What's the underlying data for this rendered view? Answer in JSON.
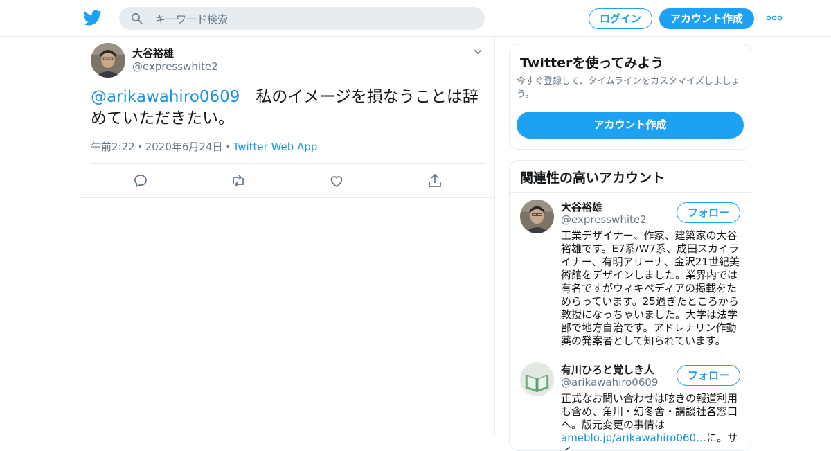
{
  "header": {
    "search_placeholder": "キーワード検索",
    "login_label": "ログイン",
    "signup_label": "アカウント作成"
  },
  "tweet": {
    "author_name": "大谷裕雄",
    "author_handle": "@expresswhite2",
    "mention": "@arikawahiro0609",
    "text": "　私のイメージを損なうことは辞めていただきたい。",
    "time": "午前2:22",
    "date": "2020年6月24日",
    "source": "Twitter Web App",
    "separator": "・"
  },
  "sidebar": {
    "try_card": {
      "title": "Twitterを使ってみよう",
      "description": "今すぐ登録して、タイムラインをカスタマイズしましょう。",
      "button_label": "アカウント作成"
    },
    "related": {
      "title": "関連性の高いアカウント",
      "follow_label": "フォロー",
      "accounts": [
        {
          "name": "大谷裕雄",
          "handle": "@expresswhite2",
          "bio": "工業デザイナー、作家、建築家の大谷裕雄です。E7系/W7系、成田スカイライナー、有明アリーナ、金沢21世紀美術館をデザインしました。業界内では有名ですがウィキペディアの掲載をためらっています。25過ぎたところから教授になっちゃいました。大学は法学部で地方自治です。アドレナリン作動薬の発案者として知られています。"
        },
        {
          "name": "有川ひろと覚しき人",
          "handle": "@arikawahiro0609",
          "bio": "正式なお問い合わせは呟きの報道利用も含め、角川・幻冬舎・講談社各窓口へ。版元変更の事情は",
          "bio_link": "ameblo.jp/arikawahiro060…",
          "bio_tail": "に。サイ"
        }
      ]
    }
  },
  "colors": {
    "accent": "#1da1f2",
    "link": "#1b95e0",
    "secondary_text": "#657786",
    "border": "#e6ecf0"
  }
}
